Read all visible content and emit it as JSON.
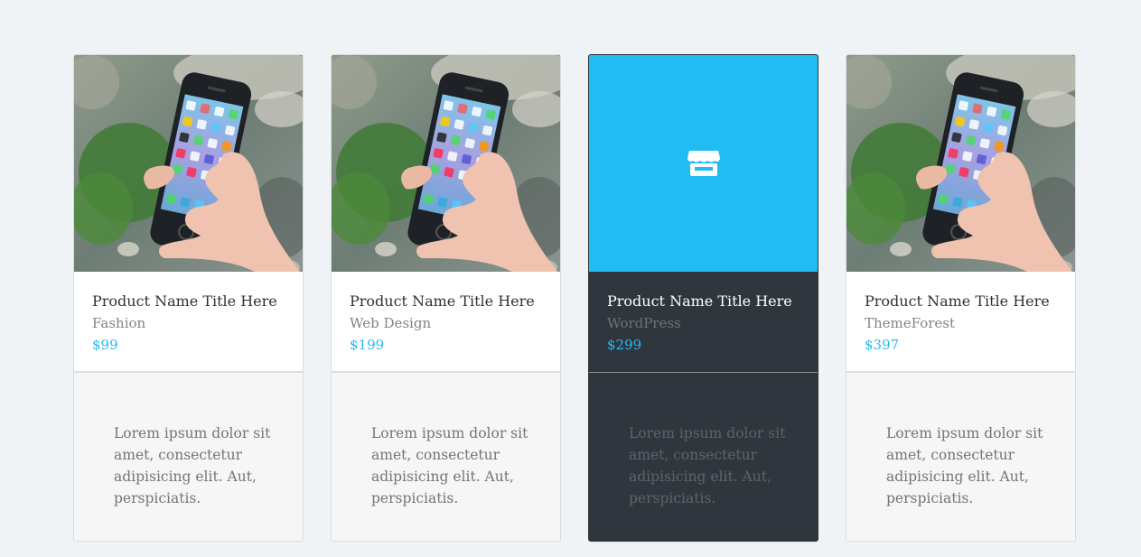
{
  "cards": [
    {
      "title": "Product Name Title Here",
      "category": "Fashion",
      "price": "$99",
      "description": "Lorem ipsum dolor sit amet, consectetur adipisicing elit. Aut, perspiciatis."
    },
    {
      "title": "Product Name Title Here",
      "category": "Web Design",
      "price": "$199",
      "description": "Lorem ipsum dolor sit amet, consectetur adipisicing elit. Aut, perspiciatis."
    },
    {
      "title": "Product Name Title Here",
      "category": "WordPress",
      "price": "$299",
      "description": "Lorem ipsum dolor sit amet, consectetur adipisicing elit. Aut, perspiciatis.",
      "icon": "store-icon"
    },
    {
      "title": "Product Name Title Here",
      "category": "ThemeForest",
      "price": "$397",
      "description": "Lorem ipsum dolor sit amet, consectetur adipisicing elit. Aut, perspiciatis."
    }
  ],
  "colors": {
    "accent": "#23bcf2",
    "dark": "#2f363d",
    "page_background": "#eff3f6"
  }
}
